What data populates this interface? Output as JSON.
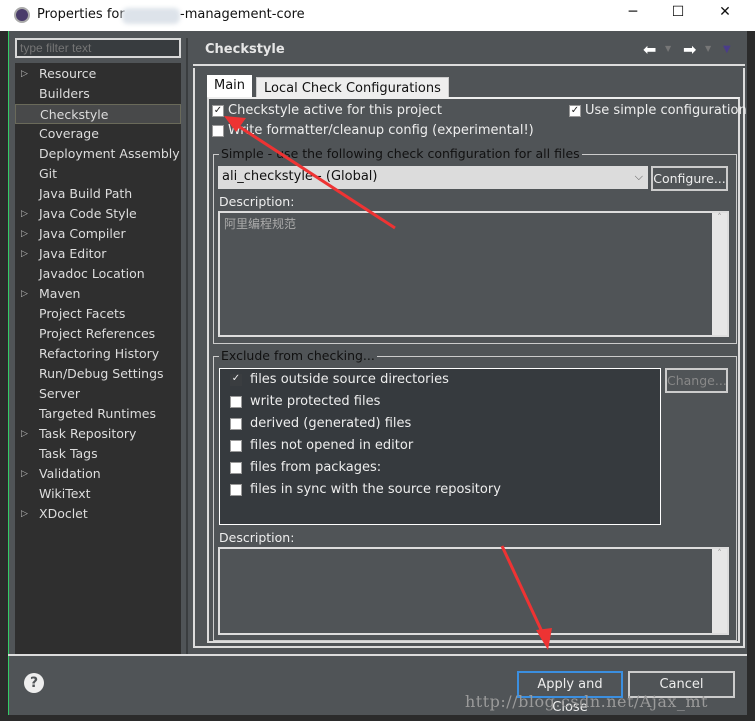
{
  "window": {
    "title_prefix": "Properties for",
    "title_suffix": "-management-core",
    "minimize": "─",
    "maximize": "☐",
    "close": "✕"
  },
  "sidebar": {
    "filter_placeholder": "type filter text",
    "items": [
      {
        "label": "Resource",
        "expandable": true
      },
      {
        "label": "Builders"
      },
      {
        "label": "Checkstyle",
        "selected": true
      },
      {
        "label": "Coverage"
      },
      {
        "label": "Deployment Assembly"
      },
      {
        "label": "Git"
      },
      {
        "label": "Java Build Path"
      },
      {
        "label": "Java Code Style",
        "expandable": true
      },
      {
        "label": "Java Compiler",
        "expandable": true
      },
      {
        "label": "Java Editor",
        "expandable": true
      },
      {
        "label": "Javadoc Location"
      },
      {
        "label": "Maven",
        "expandable": true
      },
      {
        "label": "Project Facets"
      },
      {
        "label": "Project References"
      },
      {
        "label": "Refactoring History"
      },
      {
        "label": "Run/Debug Settings"
      },
      {
        "label": "Server"
      },
      {
        "label": "Targeted Runtimes"
      },
      {
        "label": "Task Repository",
        "expandable": true
      },
      {
        "label": "Task Tags"
      },
      {
        "label": "Validation",
        "expandable": true
      },
      {
        "label": "WikiText"
      },
      {
        "label": "XDoclet",
        "expandable": true
      }
    ]
  },
  "page": {
    "title": "Checkstyle",
    "tabs": [
      {
        "label": "Main",
        "active": true
      },
      {
        "label": "Local Check Configurations"
      }
    ],
    "checkstyle_active": {
      "label": "Checkstyle active for this project",
      "checked": true
    },
    "use_simple": {
      "label": "Use simple configuration",
      "checked": true
    },
    "write_formatter": {
      "label": "Write formatter/cleanup config (experimental!)",
      "checked": false
    },
    "simple_group": {
      "label": "Simple - use the following check configuration for all files",
      "selected_config": "ali_checkstyle  - (Global)",
      "configure_label": "Configure...",
      "description_label": "Description:",
      "description": "阿里编程规范"
    },
    "exclude_group": {
      "label": "Exclude from checking...",
      "change_label": "Change...",
      "description_label": "Description:",
      "items": [
        {
          "label": "files outside source directories",
          "checked": true
        },
        {
          "label": "write protected files",
          "checked": false
        },
        {
          "label": "derived (generated) files",
          "checked": false
        },
        {
          "label": "files not opened in editor",
          "checked": false
        },
        {
          "label": "files from packages:",
          "checked": false
        },
        {
          "label": "files in sync with the source repository",
          "checked": false
        }
      ]
    }
  },
  "footer": {
    "apply_close": "Apply and Close",
    "cancel": "Cancel",
    "help": "?"
  },
  "watermark": "http://blog.csdn.net/Ajax_mt",
  "colors": {
    "annotation_arrow": "#ee3333",
    "dialog_bg": "#505457"
  }
}
